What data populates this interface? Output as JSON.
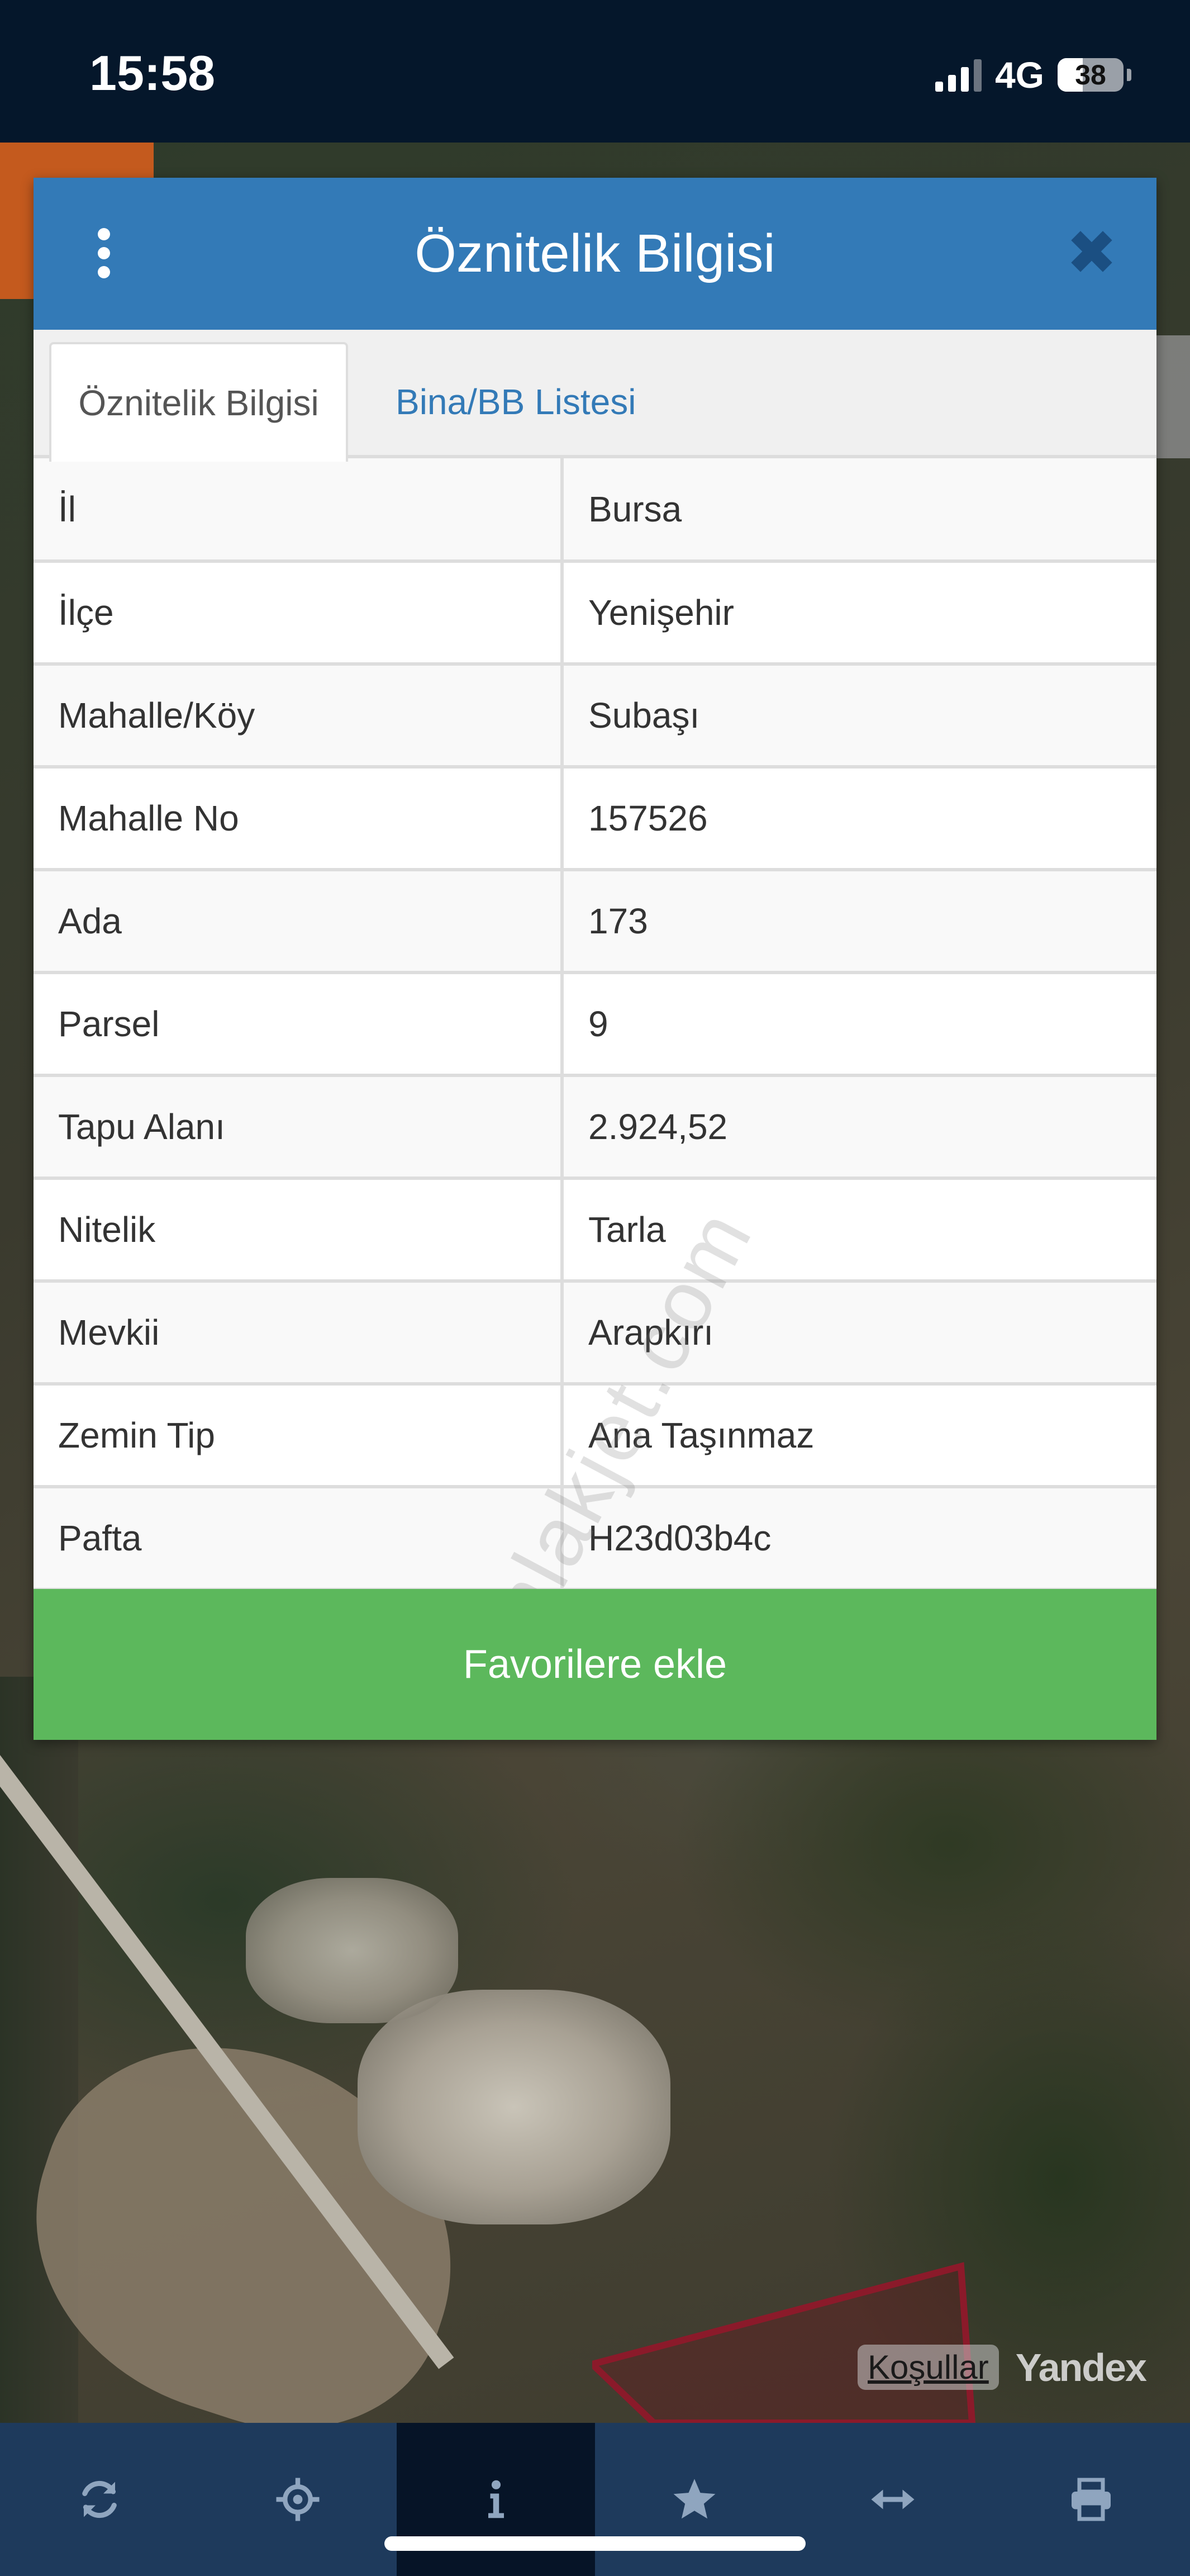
{
  "status_bar": {
    "time": "15:58",
    "network": "4G",
    "battery": "38",
    "battery_level_percent": 38
  },
  "panel": {
    "title": "Öznitelik Bilgisi",
    "menu_icon": "kebab-menu-icon",
    "close_icon": "close-icon",
    "tabs": [
      {
        "label": "Öznitelik Bilgisi",
        "active": true
      },
      {
        "label": "Bina/BB Listesi",
        "active": false
      }
    ],
    "rows": [
      {
        "label": "İl",
        "value": "Bursa"
      },
      {
        "label": "İlçe",
        "value": "Yenişehir"
      },
      {
        "label": "Mahalle/Köy",
        "value": "Subaşı"
      },
      {
        "label": "Mahalle No",
        "value": "157526"
      },
      {
        "label": "Ada",
        "value": "173"
      },
      {
        "label": "Parsel",
        "value": "9"
      },
      {
        "label": "Tapu Alanı",
        "value": "2.924,52"
      },
      {
        "label": "Nitelik",
        "value": "Tarla"
      },
      {
        "label": "Mevkii",
        "value": "Arapkırı"
      },
      {
        "label": "Zemin Tip",
        "value": "Ana Taşınmaz"
      },
      {
        "label": "Pafta",
        "value": "H23d03b4c"
      }
    ],
    "favorite_button": "Favorilere ekle",
    "watermark": "emlakjet.com"
  },
  "map": {
    "terms_link": "Koşullar",
    "provider": "Yandex"
  },
  "toolbar": {
    "items": [
      {
        "icon": "refresh-icon",
        "active": false
      },
      {
        "icon": "locate-icon",
        "active": false
      },
      {
        "icon": "info-icon",
        "active": true
      },
      {
        "icon": "star-icon",
        "active": false
      },
      {
        "icon": "measure-icon",
        "active": false
      },
      {
        "icon": "print-icon",
        "active": false
      }
    ]
  },
  "colors": {
    "header_blue": "#337ab7",
    "button_green": "#5cb85c",
    "toolbar_bg": "#1e3a5c",
    "toolbar_active": "#061427",
    "parcel_outline": "#8b1a2a"
  }
}
